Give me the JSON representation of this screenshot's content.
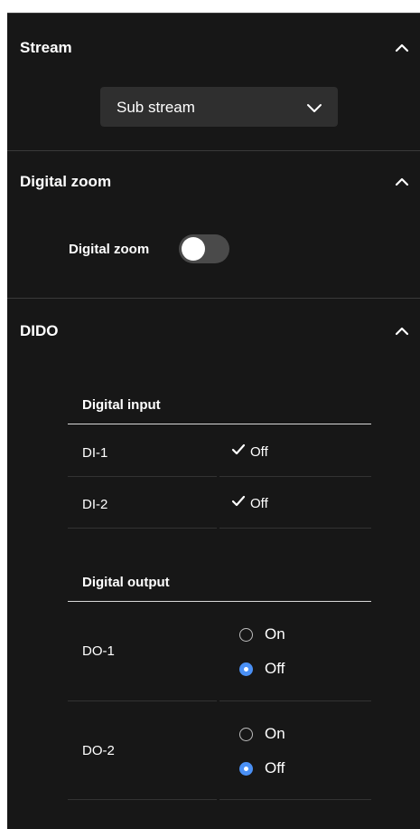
{
  "stream": {
    "title": "Stream",
    "selected": "Sub stream"
  },
  "digital_zoom": {
    "title": "Digital zoom",
    "label": "Digital zoom",
    "enabled": false
  },
  "dido": {
    "title": "DIDO",
    "digital_input": {
      "title": "Digital input",
      "rows": [
        {
          "name": "DI-1",
          "status": "Off"
        },
        {
          "name": "DI-2",
          "status": "Off"
        }
      ]
    },
    "digital_output": {
      "title": "Digital output",
      "rows": [
        {
          "name": "DO-1",
          "options": [
            "On",
            "Off"
          ],
          "selected": "Off"
        },
        {
          "name": "DO-2",
          "options": [
            "On",
            "Off"
          ],
          "selected": "Off"
        }
      ]
    }
  },
  "colors": {
    "panel_bg": "#171717",
    "select_bg": "#2f2f2f",
    "accent": "#4a90f5",
    "divider": "#3a3a3a"
  },
  "icons": {
    "collapse": "chevron-up-icon",
    "dropdown": "chevron-down-icon",
    "status": "check-icon"
  }
}
